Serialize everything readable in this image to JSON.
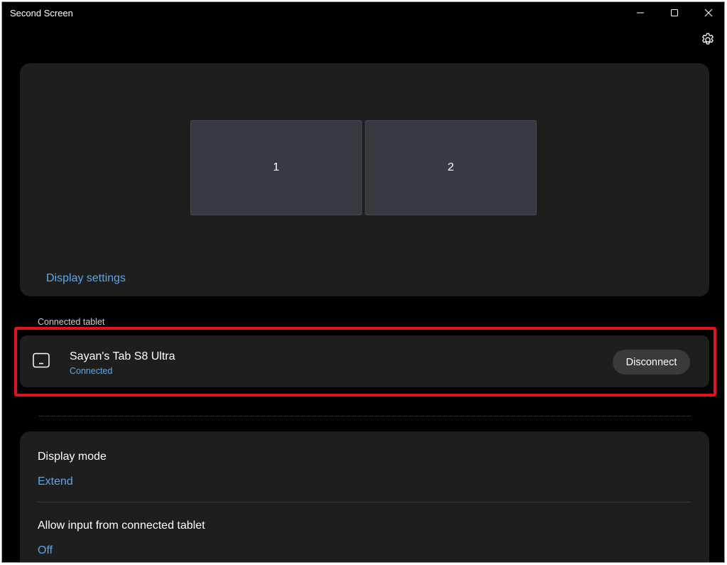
{
  "window": {
    "title": "Second Screen"
  },
  "window_controls": {
    "minimize_icon": "minimize-icon",
    "maximize_icon": "maximize-icon",
    "close_icon": "close-icon"
  },
  "header": {
    "settings_icon": "gear-icon"
  },
  "arrangement": {
    "displays": [
      "1",
      "2"
    ],
    "display_settings_link": "Display settings"
  },
  "connected_tablet": {
    "section_label": "Connected tablet",
    "device_icon": "tablet-icon",
    "device_name": "Sayan's Tab S8 Ultra",
    "status": "Connected",
    "disconnect_label": "Disconnect"
  },
  "settings": {
    "display_mode": {
      "title": "Display mode",
      "value": "Extend"
    },
    "allow_input": {
      "title": "Allow input from connected tablet",
      "value": "Off"
    }
  },
  "colors": {
    "accent": "#5aa7f0",
    "card_background": "#1e1e1e",
    "window_background": "#000000",
    "highlight": "#e0141c"
  }
}
